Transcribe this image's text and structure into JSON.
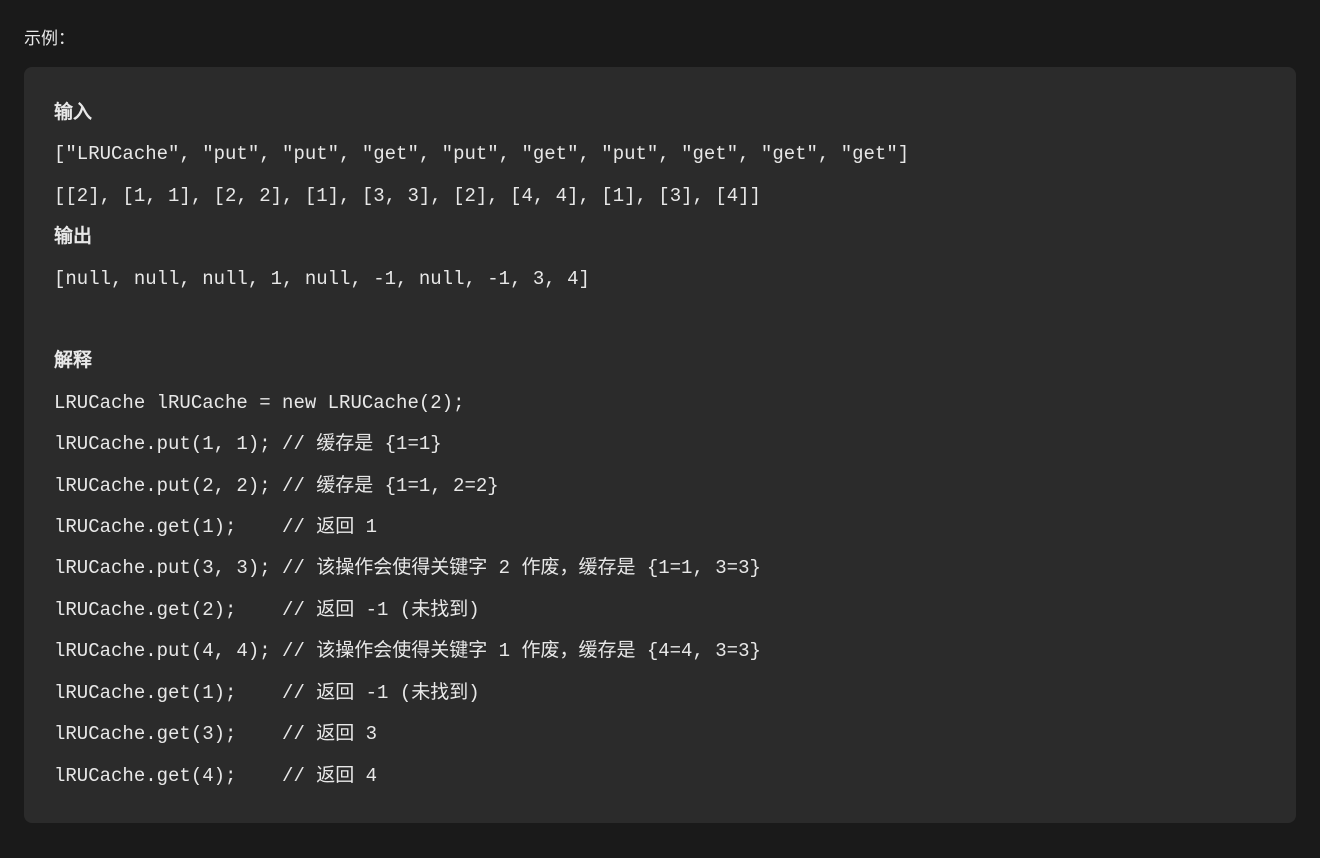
{
  "label": "示例：",
  "code": {
    "lines": [
      {
        "text": "输入",
        "bold": true
      },
      {
        "text": "[\"LRUCache\", \"put\", \"put\", \"get\", \"put\", \"get\", \"put\", \"get\", \"get\", \"get\"]",
        "bold": false
      },
      {
        "text": "[[2], [1, 1], [2, 2], [1], [3, 3], [2], [4, 4], [1], [3], [4]]",
        "bold": false
      },
      {
        "text": "输出",
        "bold": true
      },
      {
        "text": "[null, null, null, 1, null, -1, null, -1, 3, 4]",
        "bold": false
      },
      {
        "text": "",
        "bold": false
      },
      {
        "text": "解释",
        "bold": true
      },
      {
        "text": "LRUCache lRUCache = new LRUCache(2);",
        "bold": false
      },
      {
        "text": "lRUCache.put(1, 1); // 缓存是 {1=1}",
        "bold": false
      },
      {
        "text": "lRUCache.put(2, 2); // 缓存是 {1=1, 2=2}",
        "bold": false
      },
      {
        "text": "lRUCache.get(1);    // 返回 1",
        "bold": false
      },
      {
        "text": "lRUCache.put(3, 3); // 该操作会使得关键字 2 作废，缓存是 {1=1, 3=3}",
        "bold": false
      },
      {
        "text": "lRUCache.get(2);    // 返回 -1 (未找到)",
        "bold": false
      },
      {
        "text": "lRUCache.put(4, 4); // 该操作会使得关键字 1 作废，缓存是 {4=4, 3=3}",
        "bold": false
      },
      {
        "text": "lRUCache.get(1);    // 返回 -1 (未找到)",
        "bold": false
      },
      {
        "text": "lRUCache.get(3);    // 返回 3",
        "bold": false
      },
      {
        "text": "lRUCache.get(4);    // 返回 4",
        "bold": false
      }
    ]
  }
}
